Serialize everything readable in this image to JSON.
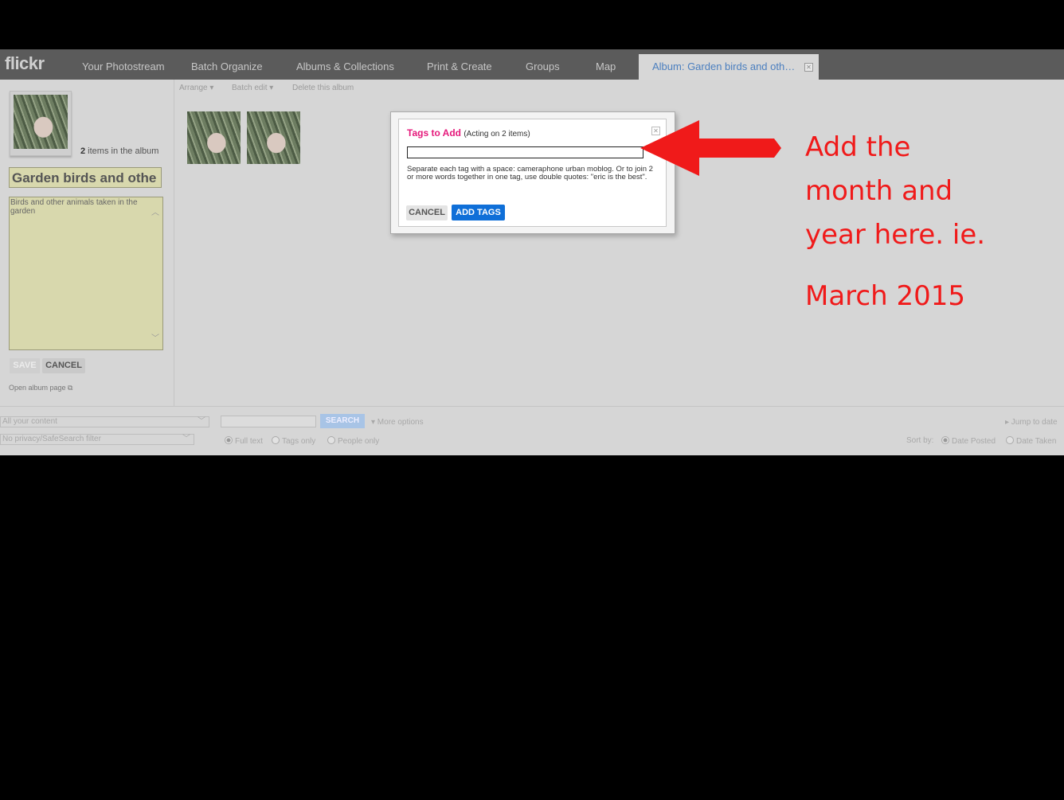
{
  "nav": {
    "logo": "flickr",
    "items": [
      "Your Photostream",
      "Batch Organize",
      "Albums & Collections",
      "Print & Create",
      "Groups",
      "Map"
    ],
    "active_tab": "Album: Garden birds and oth…",
    "close_glyph": "✕"
  },
  "toolbar": {
    "arrange": "Arrange ▾",
    "batch_edit": "Batch edit ▾",
    "delete": "Delete this album"
  },
  "sidebar": {
    "count_number": "2",
    "count_text": " items in the album",
    "title_value": "Garden birds and othe",
    "description": "Birds and other animals taken in the garden",
    "save_label": "SAVE",
    "cancel_label": "CANCEL",
    "open_album": "Open album page ⧉"
  },
  "dialog": {
    "title": "Tags to Add",
    "subtitle": "(Acting on 2 items)",
    "input_value": "",
    "help": "Separate each tag with a space: cameraphone urban moblog. Or to join 2 or more words together in one tag, use double quotes: \"eric is the best\".",
    "cancel_label": "CANCEL",
    "add_label": "ADD TAGS",
    "close_glyph": "✕"
  },
  "footer": {
    "content_select": "All your content",
    "privacy_select": "No privacy/SafeSearch filter",
    "search_label": "SEARCH",
    "more_options": "▾ More options",
    "full_text": "Full text",
    "tags_only": "Tags only",
    "people_only": "People only",
    "jump_to_date": "▸ Jump to date",
    "sort_by": "Sort by:",
    "date_posted": "Date Posted",
    "date_taken": "Date Taken"
  },
  "annotation": {
    "line1": "Add the",
    "line2": "month and",
    "line3": "year here. ie.",
    "line4": "March 2015",
    "color": "#f01a1a"
  }
}
